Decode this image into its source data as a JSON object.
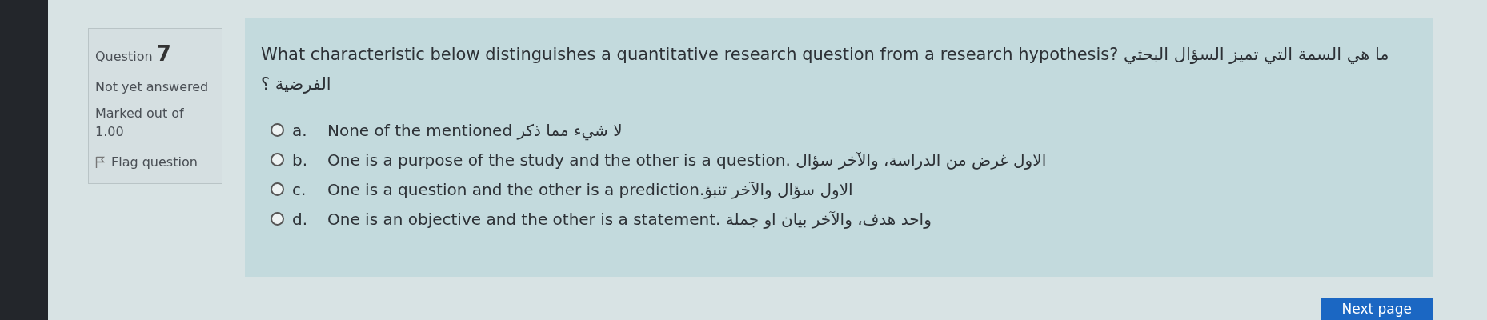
{
  "question_info": {
    "label": "Question",
    "number": "7",
    "status": "Not yet answered",
    "marked": "Marked out of 1.00",
    "flag": {
      "label": "Flag question",
      "flagged": false
    }
  },
  "question": {
    "text": "What characteristic below distinguishes a quantitative research question from a research hypothesis? ما هي السمة التي تميز السؤال البحثي الفرضية ؟",
    "options": [
      {
        "letter": "a.",
        "text": "None of the mentioned لا شيء مما ذكر",
        "selected": false
      },
      {
        "letter": "b.",
        "text": "One is a purpose of the study and the other is a question. الاول غرض من الدراسة، والآخر سؤال",
        "selected": false
      },
      {
        "letter": "c.",
        "text": "One is a question and the other is a prediction.الاول سؤال والآخر تنبؤ",
        "selected": false
      },
      {
        "letter": "d.",
        "text": "One is an objective and the other is a statement. واحد هدف، والآخر بيان او جملة",
        "selected": false
      }
    ]
  },
  "next_button": "Next page"
}
